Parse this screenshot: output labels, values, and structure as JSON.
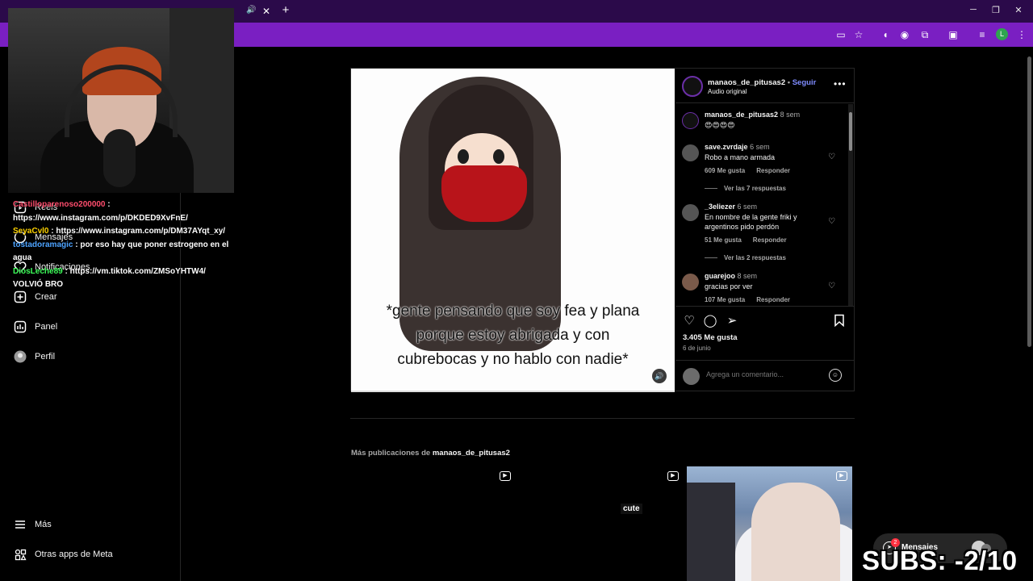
{
  "browser": {
    "window_controls": {
      "minimize": "─",
      "restore": "❐",
      "close": "✕"
    },
    "toolbar_icons": [
      "cast-icon",
      "star-icon",
      "extension-icon",
      "puzzle-icon",
      "media-icon",
      "reading-list-icon"
    ],
    "profile_initial": "L"
  },
  "sidebar": {
    "items": [
      {
        "label": "Reels",
        "icon": "reels-icon"
      },
      {
        "label": "Mensajes",
        "icon": "messages-icon"
      },
      {
        "label": "Notificaciones",
        "icon": "heart-icon"
      },
      {
        "label": "Crear",
        "icon": "plus-icon"
      },
      {
        "label": "Panel",
        "icon": "dashboard-icon"
      },
      {
        "label": "Perfil",
        "icon": "profile-avatar"
      }
    ],
    "bottom_items": [
      {
        "label": "Más",
        "icon": "menu-icon"
      },
      {
        "label": "Otras apps de Meta",
        "icon": "meta-apps-icon"
      }
    ]
  },
  "chat": {
    "messages": [
      {
        "user": "Castilloparenoso200000",
        "user_color": "#ff4d6d",
        "text": "https://www.instagram.com/p/DKDED9XvFnE/"
      },
      {
        "user": "SeyaCvl0",
        "user_color": "#ffd400",
        "text": "https://www.instagram.com/p/DM37AYqt_xy/"
      },
      {
        "user": "tostadoramagic",
        "user_color": "#4da3ff",
        "text": "por eso hay que poner estrogeno en el agua"
      },
      {
        "user": "DiosLeche89",
        "user_color": "#3dff5a",
        "text": "https://vm.tiktok.com/ZMSoYHTW4/"
      },
      {
        "user": "",
        "user_color": "#ffffff",
        "text": "VOLVIÓ BRO"
      }
    ]
  },
  "post": {
    "caption_lines": [
      "*gente pensando que soy fea y plana",
      "porque estoy abrigada y con",
      "cubrebocas y no hablo con nadie*"
    ],
    "author": "manaos_de_pitusas2",
    "follow_label": "Seguir",
    "audio": "Audio original",
    "likes": "3.405 Me gusta",
    "date": "6 de junio",
    "comment_placeholder": "Agrega un comentario...",
    "comments": [
      {
        "user": "manaos_de_pitusas2",
        "time": "8 sem",
        "text": "😍😍😍😍",
        "likes": "",
        "reply": "",
        "replies": ""
      },
      {
        "user": "save.zvrdaje",
        "time": "6 sem",
        "text": "Robo a mano armada",
        "likes": "609 Me gusta",
        "reply": "Responder",
        "replies": "Ver las 7 respuestas"
      },
      {
        "user": "_3eliezer",
        "time": "6 sem",
        "text": "En nombre de la gente friki y argentinos pido perdón",
        "likes": "51 Me gusta",
        "reply": "Responder",
        "replies": "Ver las 2 respuestas"
      },
      {
        "user": "guarejoo",
        "time": "8 sem",
        "text": "gracias por ver",
        "likes": "107 Me gusta",
        "reply": "Responder",
        "replies": ""
      }
    ]
  },
  "more_posts": {
    "prefix": "Más publicaciones de",
    "author": "manaos_de_pitusas2",
    "tile2_text": "cute"
  },
  "messages_bubble": {
    "label": "Mensajes",
    "badge": "2"
  },
  "overlay": {
    "subs": "SUBS: -2/10"
  }
}
